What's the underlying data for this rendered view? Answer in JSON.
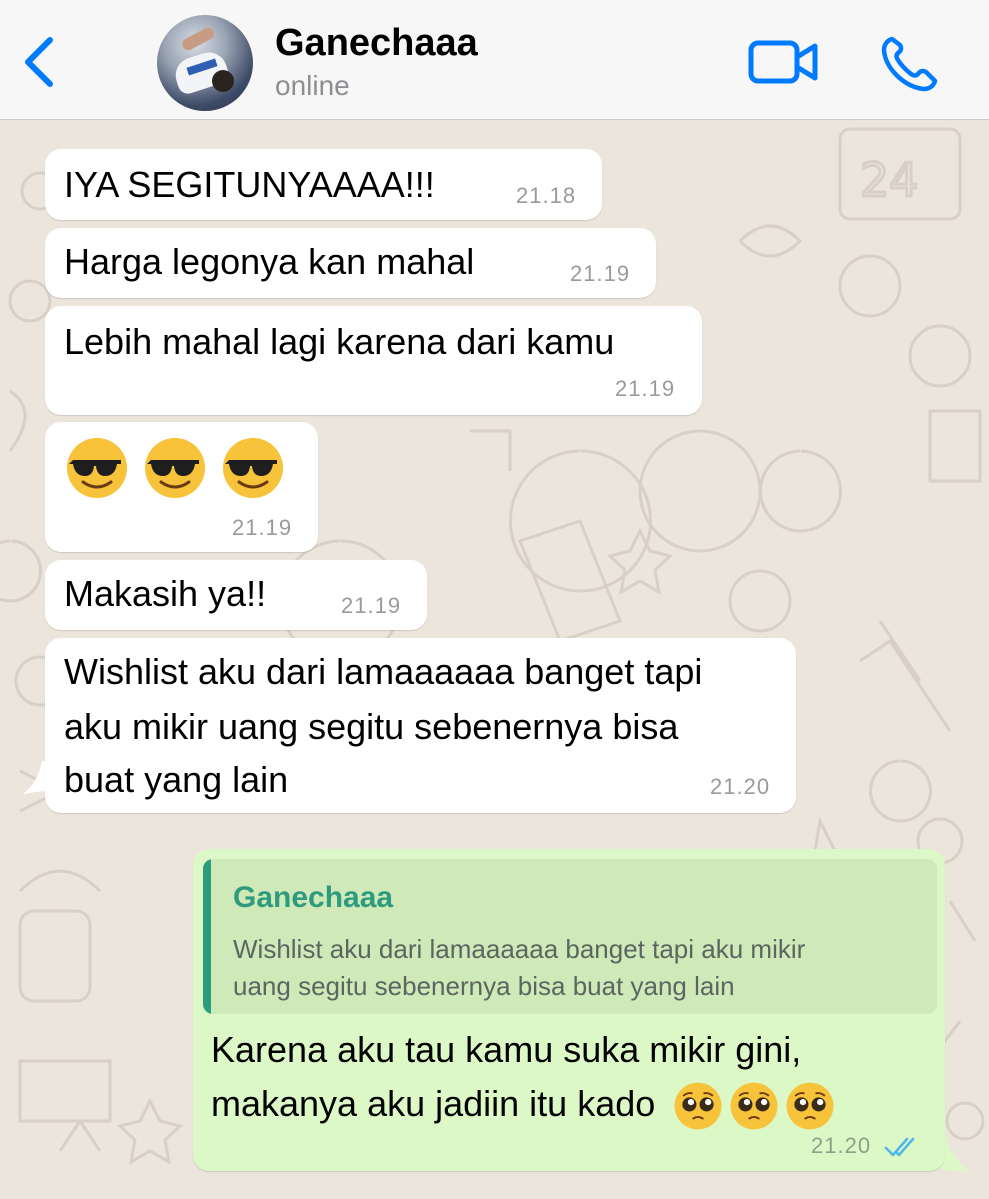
{
  "header": {
    "contact_name": "Ganechaaa",
    "status": "online",
    "back_icon": "chevron-left-icon",
    "video_icon": "video-camera-icon",
    "call_icon": "phone-icon",
    "accent_color": "#007aff"
  },
  "messages": [
    {
      "direction": "incoming",
      "text": "IYA SEGITUNYAAAA!!!",
      "time": "21.18"
    },
    {
      "direction": "incoming",
      "text": "Harga legonya kan mahal",
      "time": "21.19"
    },
    {
      "direction": "incoming",
      "text": "Lebih mahal lagi karena dari kamu",
      "time": "21.19"
    },
    {
      "direction": "incoming",
      "emoji": [
        "smiling-face-with-sunglasses",
        "smiling-face-with-sunglasses",
        "smiling-face-with-sunglasses"
      ],
      "time": "21.19"
    },
    {
      "direction": "incoming",
      "text": "Makasih ya!!",
      "time": "21.19"
    },
    {
      "direction": "incoming",
      "lines": [
        "Wishlist aku dari lamaaaaaa banget tapi",
        "aku mikir uang segitu sebenernya bisa",
        "buat yang lain"
      ],
      "time": "21.20"
    },
    {
      "direction": "outgoing",
      "reply_to": {
        "name": "Ganechaaa",
        "lines": [
          "Wishlist aku dari lamaaaaaa banget tapi aku mikir",
          "uang segitu sebenernya bisa buat yang lain"
        ]
      },
      "lines": [
        "Karena aku tau kamu suka mikir gini,",
        "makanya aku jadiin itu kado"
      ],
      "emoji": [
        "pleading-face",
        "pleading-face",
        "pleading-face"
      ],
      "time": "21.20",
      "status_icon": "double-check-read-icon"
    }
  ],
  "colors": {
    "outgoing_bubble": "#dcf8c6",
    "incoming_bubble": "#ffffff",
    "quote_accent": "#2a9d7d",
    "read_ticks": "#4fb6ec"
  }
}
